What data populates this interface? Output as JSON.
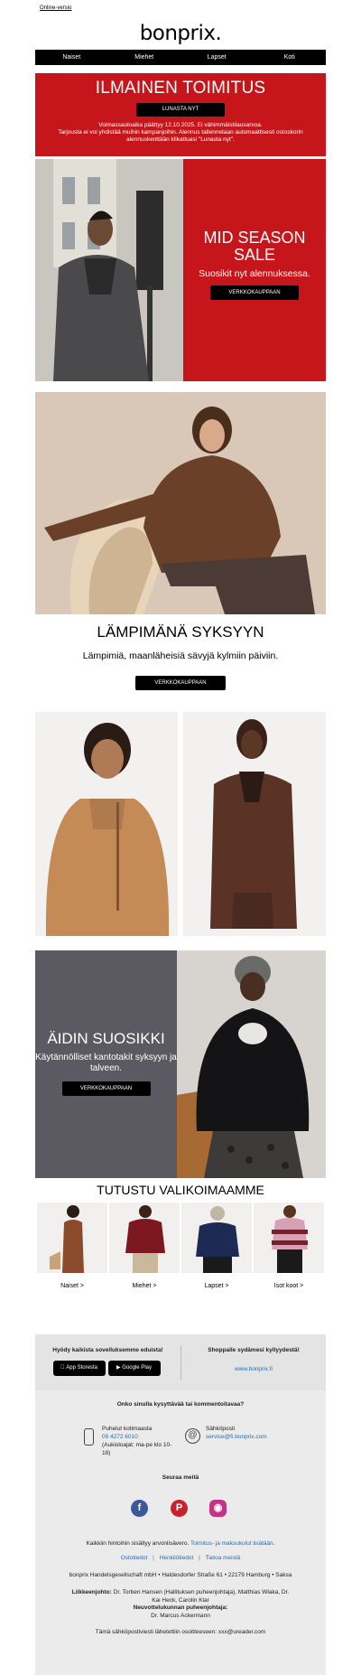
{
  "header": {
    "online_link": "Online-versio",
    "logo": "bonprix."
  },
  "nav": [
    "Naiset",
    "Miehet",
    "Lapset",
    "Koti"
  ],
  "promo": {
    "title": "ILMAINEN TOIMITUS",
    "button": "LUNASTA NYT",
    "line1": "Voimassaoloaika päättyy 12.10.2025. Ei vähimmäistilausarvoa.",
    "line2": "Tarjousta ei voi yhdistää muihin kampanjoihin. Alennus tallennetaan automaattisesti ostoskorin alennuskenttään klikattuasi \"Lunasta nyt\"."
  },
  "hero1": {
    "title": "MID SEASON SALE",
    "subtitle": "Suosikit nyt alennuksessa.",
    "button": "VERKKOKAUPPAAN"
  },
  "section2": {
    "title": "LÄMPIMÄNÄ SYKSYYN",
    "subtitle": "Lämpimiä, maanläheisiä sävyjä kylmiin päiviin.",
    "button": "VERKKOKAUPPAAN"
  },
  "hero3": {
    "title": "ÄIDIN SUOSIKKI",
    "subtitle": "Käytännölliset kantotakit syksyyn ja talveen.",
    "button": "VERKKOKAUPPAAN"
  },
  "categories": {
    "title": "TUTUSTU VALIKOIMAAMME",
    "items": [
      "Naiset >",
      "Miehet >",
      "Lapset >",
      "Isot koot >"
    ]
  },
  "footer": {
    "app_title": "Hyödy kaikista sovelluksemme eduista!",
    "app_store": "App Storesta",
    "google_play": "Google Play",
    "shop_title": "Shoppaile sydämesi kyllyydestä!",
    "shop_link": "www.bonprix.fi",
    "questions": "Onko sinulla kysyttävää tai kommentoitavaa?",
    "phone_title": "Puhelut kotimaasta",
    "phone_number": "09 4272 6010",
    "phone_hours": "(Aukioloajat: ma-pe klo 10-18)",
    "email_title": "Sähköposti",
    "email": "service@fi.bonprix.com",
    "follow": "Seuraa meitä",
    "vat_text": "Kaikkiin hintoihin sisältyy arvonlisävero.",
    "vat_link": "Toimitus- ja maksukulut lisätään.",
    "links": [
      "Ostotiedot",
      "Henkilötiedot",
      "Tietoa meistä"
    ],
    "address": "bonprix Handelsgesellschaft mbH • Haldesdorfer Straße 61 • 22179 Hamburg • Saksa",
    "mgmt_label": "Liikkeenjohto:",
    "mgmt": "Dr. Torben Hansen (Hallituksen puheenjohtaja), Matthias Wlaka, Dr. Kai Heck, Carolin Klar",
    "board_label": "Neuvottelukunnan puheenjohtaja:",
    "board": "Dr. Marcus Ackermann",
    "sent_to": "Tämä sähköpostiviesti lähetettiin osoitteeseen: xxx@ureader.com"
  }
}
